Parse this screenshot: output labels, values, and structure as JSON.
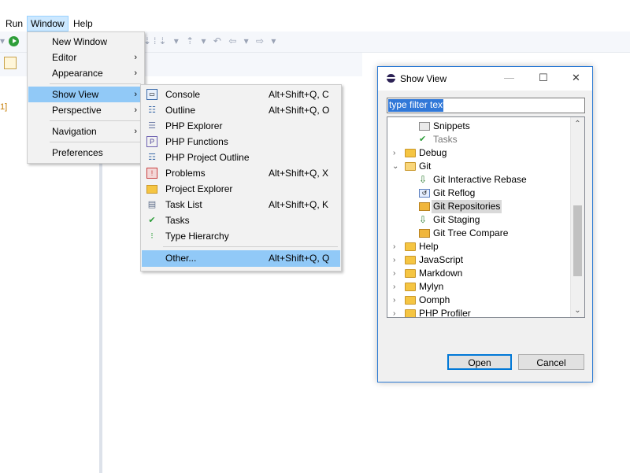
{
  "menubar": {
    "items": [
      "Run",
      "Window",
      "Help"
    ],
    "active": "Window"
  },
  "left_panel": {
    "label": "1]"
  },
  "window_menu": {
    "items": [
      {
        "label": "New Window",
        "submenu": false
      },
      {
        "label": "Editor",
        "submenu": true
      },
      {
        "label": "Appearance",
        "submenu": true
      },
      {
        "label": "Show View",
        "submenu": true,
        "selected": true
      },
      {
        "label": "Perspective",
        "submenu": true
      },
      {
        "label": "Navigation",
        "submenu": true
      },
      {
        "label": "Preferences",
        "submenu": false
      }
    ]
  },
  "show_view_menu": {
    "items": [
      {
        "label": "Console",
        "shortcut": "Alt+Shift+Q, C",
        "icon": "console-icon"
      },
      {
        "label": "Outline",
        "shortcut": "Alt+Shift+Q, O",
        "icon": "outline-icon"
      },
      {
        "label": "PHP Explorer",
        "shortcut": "",
        "icon": "php-explorer-icon"
      },
      {
        "label": "PHP Functions",
        "shortcut": "",
        "icon": "php-functions-icon"
      },
      {
        "label": "PHP Project Outline",
        "shortcut": "",
        "icon": "php-project-outline-icon"
      },
      {
        "label": "Problems",
        "shortcut": "Alt+Shift+Q, X",
        "icon": "problems-icon"
      },
      {
        "label": "Project Explorer",
        "shortcut": "",
        "icon": "project-explorer-icon"
      },
      {
        "label": "Task List",
        "shortcut": "Alt+Shift+Q, K",
        "icon": "task-list-icon"
      },
      {
        "label": "Tasks",
        "shortcut": "",
        "icon": "tasks-icon"
      },
      {
        "label": "Type Hierarchy",
        "shortcut": "",
        "icon": "type-hierarchy-icon"
      },
      {
        "label": "Other...",
        "shortcut": "Alt+Shift+Q, Q",
        "icon": "",
        "selected": true
      }
    ]
  },
  "dialog": {
    "title": "Show View",
    "controls": {
      "minimize": "—",
      "maximize": "☐",
      "close": "✕"
    },
    "filter": {
      "value": "type filter text"
    },
    "tree": [
      {
        "label": "Snippets",
        "type": "view",
        "level": 2
      },
      {
        "label": "Tasks",
        "type": "view",
        "level": 2,
        "dim": true
      },
      {
        "label": "Debug",
        "type": "folder",
        "level": 1,
        "expanded": false
      },
      {
        "label": "Git",
        "type": "folder",
        "level": 1,
        "expanded": true
      },
      {
        "label": "Git Interactive Rebase",
        "type": "view",
        "level": 2
      },
      {
        "label": "Git Reflog",
        "type": "view",
        "level": 2
      },
      {
        "label": "Git Repositories",
        "type": "view",
        "level": 2,
        "selected": true
      },
      {
        "label": "Git Staging",
        "type": "view",
        "level": 2
      },
      {
        "label": "Git Tree Compare",
        "type": "view",
        "level": 2
      },
      {
        "label": "Help",
        "type": "folder",
        "level": 1,
        "expanded": false
      },
      {
        "label": "JavaScript",
        "type": "folder",
        "level": 1,
        "expanded": false
      },
      {
        "label": "Markdown",
        "type": "folder",
        "level": 1,
        "expanded": false
      },
      {
        "label": "Mylyn",
        "type": "folder",
        "level": 1,
        "expanded": false
      },
      {
        "label": "Oomph",
        "type": "folder",
        "level": 1,
        "expanded": false
      },
      {
        "label": "PHP Profiler",
        "type": "folder",
        "level": 1,
        "expanded": false
      }
    ],
    "buttons": {
      "open": "Open",
      "cancel": "Cancel"
    }
  },
  "colors": {
    "accent": "#0078d7",
    "menu_selected": "#91c9f7",
    "folder": "#f5c542"
  }
}
